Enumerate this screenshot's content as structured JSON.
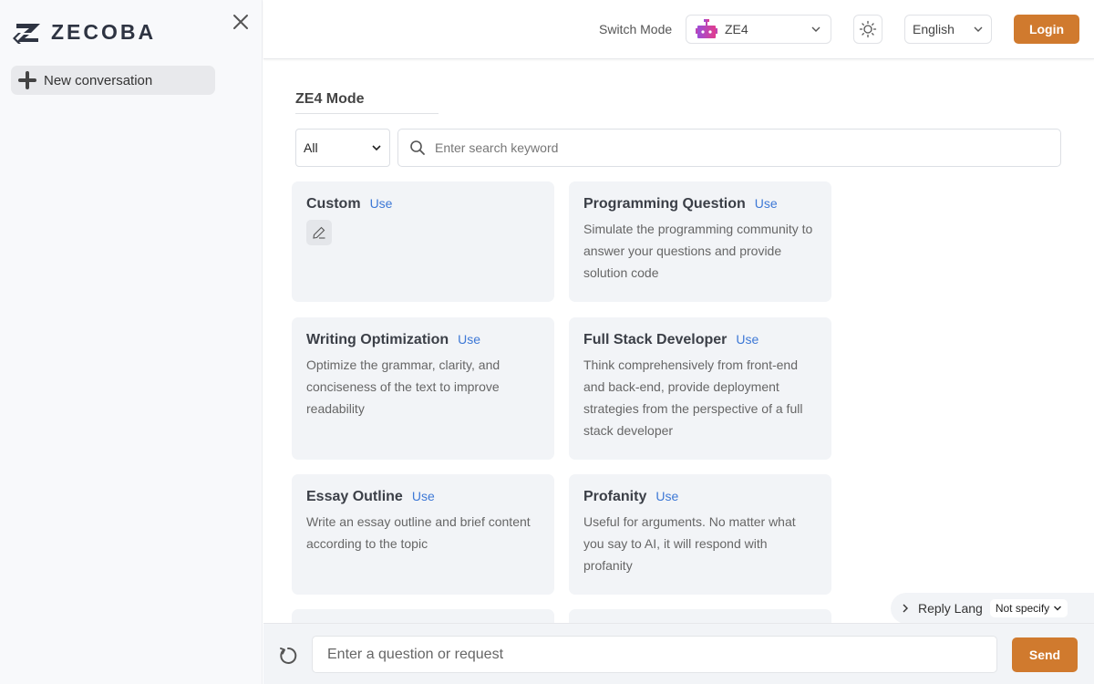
{
  "brand": {
    "name": "ZECOBA"
  },
  "sidebar": {
    "new_conversation_label": "New conversation"
  },
  "header": {
    "switch_mode_label": "Switch Mode",
    "mode_value": "ZE4",
    "language_value": "English",
    "login_label": "Login",
    "accent_color": "#d07a2e"
  },
  "main": {
    "mode_title": "ZE4 Mode",
    "category_value": "All",
    "search_placeholder": "Enter search keyword",
    "use_label": "Use",
    "cards": [
      {
        "name": "Custom",
        "desc": "",
        "has_edit": true
      },
      {
        "name": "Programming Question",
        "desc": "Simulate the programming community to answer your questions and provide solution code"
      },
      {
        "name": "Writing Optimization",
        "desc": "Optimize the grammar, clarity, and conciseness of the text to improve readability"
      },
      {
        "name": "Full Stack Developer",
        "desc": "Think comprehensively from front-end and back-end, provide deployment strategies from the perspective of a full stack developer"
      },
      {
        "name": "Essay Outline",
        "desc": "Write an essay outline and brief content according to the topic"
      },
      {
        "name": "Profanity",
        "desc": "Useful for arguments. No matter what you say to AI, it will respond with profanity"
      },
      {
        "name": "",
        "desc": ""
      },
      {
        "name": "",
        "desc": ""
      }
    ]
  },
  "reply_lang": {
    "label": "Reply Lang",
    "value": "Not specify"
  },
  "footer": {
    "input_placeholder": "Enter a question or request",
    "send_label": "Send"
  }
}
